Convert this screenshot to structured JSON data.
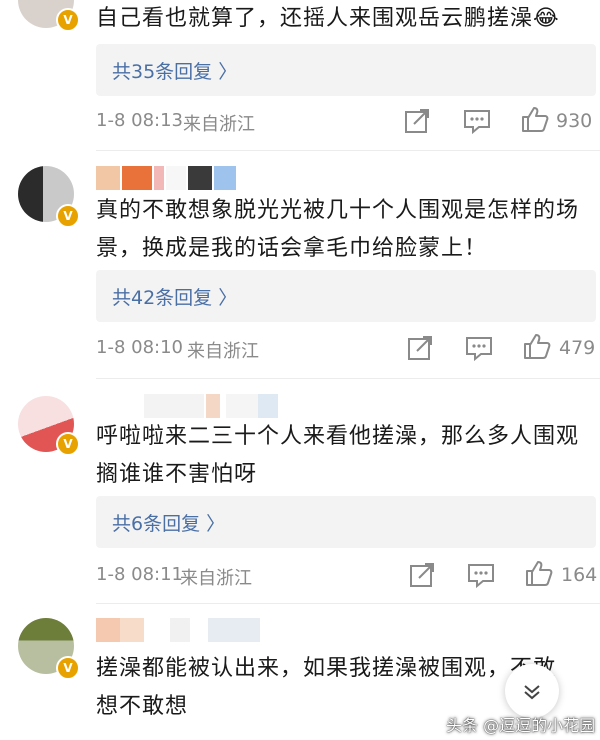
{
  "comments": [
    {
      "text_line1": "自己看也就算了，还摇人来围观岳云鹏搓澡😂",
      "replies_label": "共35条回复 〉",
      "timestamp": "1-8 08:13",
      "location": "来自浙江",
      "likes": "930",
      "icons": [
        "share-icon",
        "comment-icon",
        "like-icon"
      ]
    },
    {
      "text_line1": "真的不敢想象脱光光被几十个人围观是怎样的场",
      "text_line2": "景，换成是我的话会拿毛巾给脸蒙上！",
      "replies_label": "共42条回复 〉",
      "timestamp": "1-8 08:10",
      "location": "来自浙江",
      "likes": "479"
    },
    {
      "text_line1": "呼啦啦来二三十个人来看他搓澡，那么多人围观",
      "text_line2": "搁谁谁不害怕呀",
      "replies_label": "共6条回复 〉",
      "timestamp": "1-8 08:11",
      "location": "来自浙江",
      "likes": "164"
    },
    {
      "text_line1": "搓澡都能被认出来，如果我搓澡被围观，不敢",
      "text_line2": "想不敢想"
    }
  ],
  "watermark": "头条 @逗逗的小花园",
  "colors": {
    "link": "#4a6fa5",
    "meta": "#8a8a8a",
    "badge": "#e8a200",
    "reply_bg": "#f3f3f3"
  }
}
